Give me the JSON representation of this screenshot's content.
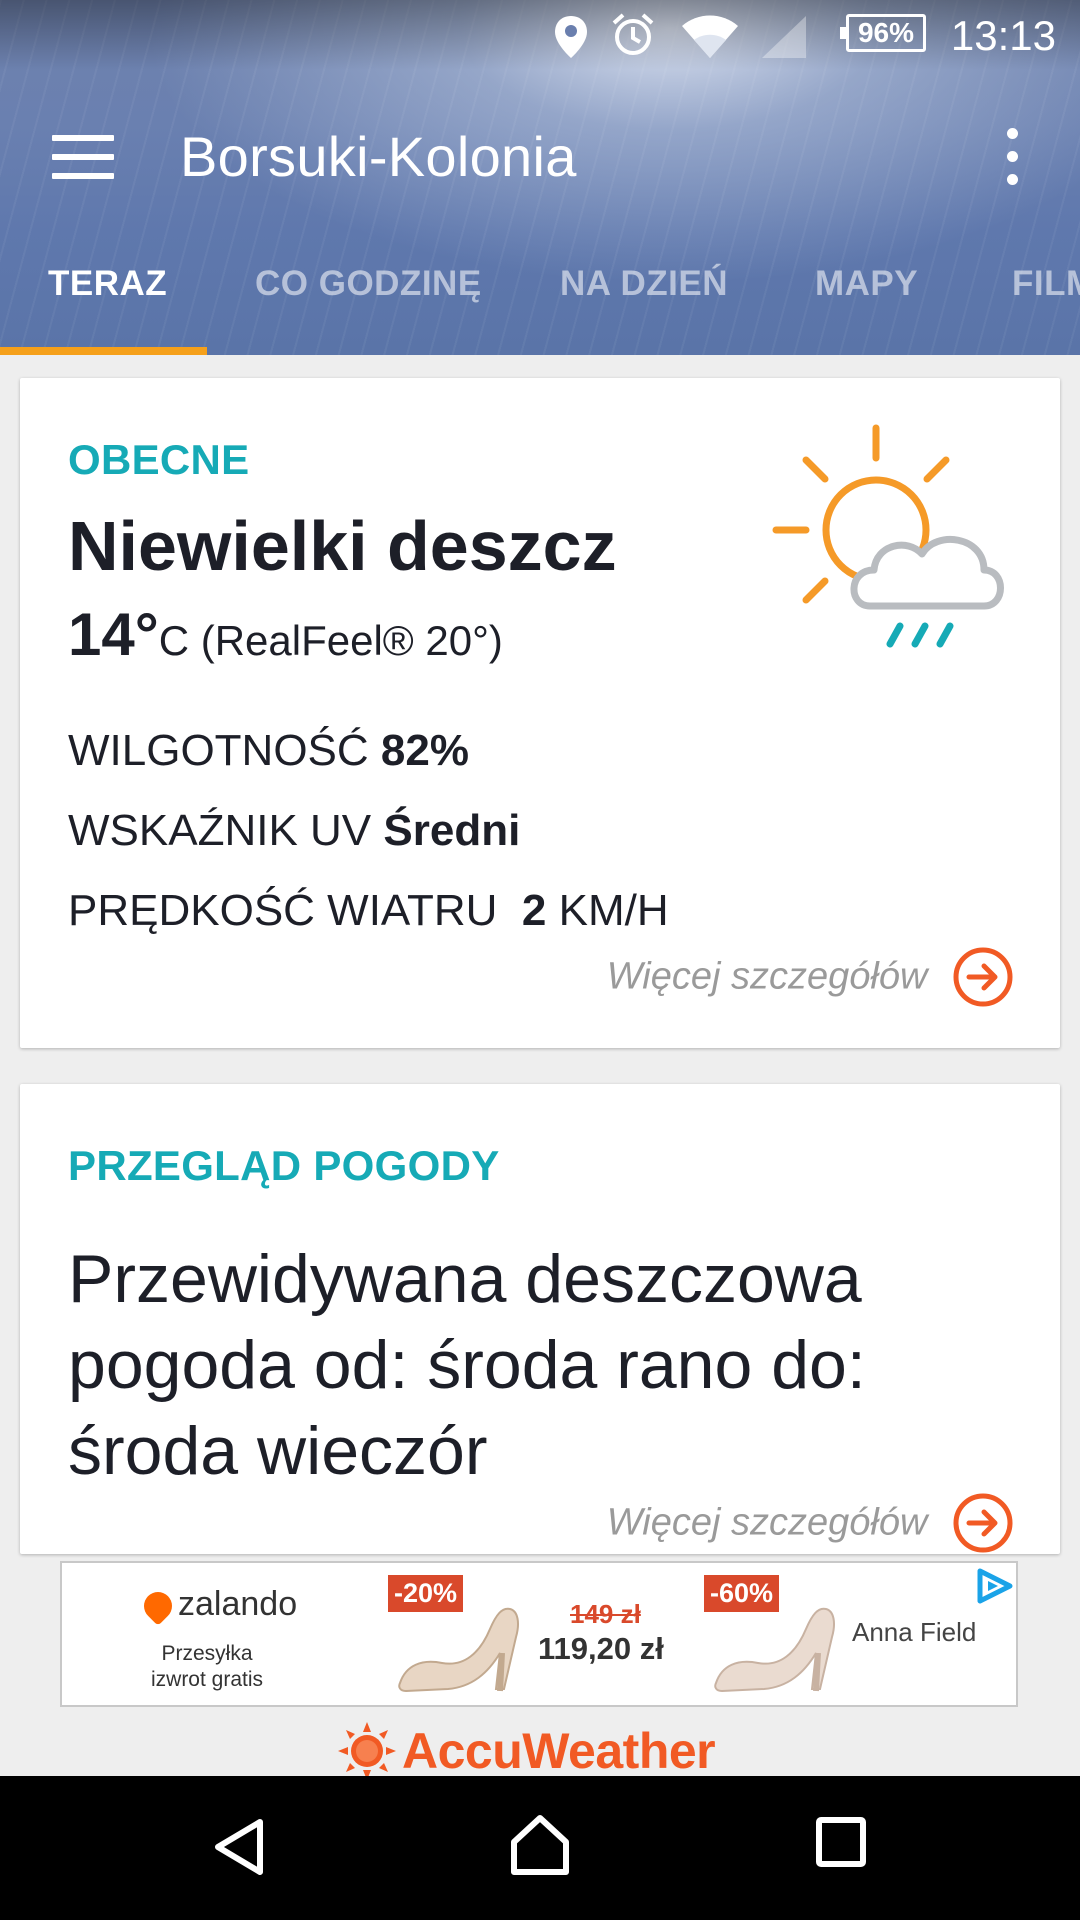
{
  "status_bar": {
    "time": "13:13",
    "battery": "96%",
    "icons": [
      "location-icon",
      "alarm-icon",
      "wifi-icon",
      "signal-icon",
      "battery-icon"
    ]
  },
  "toolbar": {
    "title": "Borsuki-Kolonia",
    "menu_icon": "hamburger-menu-icon",
    "overflow_icon": "more-vert-icon"
  },
  "tabs": [
    {
      "label": "TERAZ",
      "active": true
    },
    {
      "label": "CO GODZINĘ",
      "active": false
    },
    {
      "label": "NA DZIEŃ",
      "active": false
    },
    {
      "label": "MAPY",
      "active": false
    },
    {
      "label": "FILM",
      "active": false
    }
  ],
  "current": {
    "section_label": "OBECNE",
    "condition": "Niewielki deszcz",
    "temperature": "14°",
    "unit_realfeel": "C (RealFeel® 20°)",
    "humidity_label": "WILGOTNOŚĆ",
    "humidity_value": "82%",
    "uv_label": "WSKAŹNIK UV",
    "uv_value": "Średni",
    "wind_label": "PRĘDKOŚĆ WIATRU",
    "wind_value": "2",
    "wind_unit": "KM/H",
    "more_link": "Więcej szczegółów",
    "icon": "sun-cloud-rain-icon"
  },
  "overview": {
    "section_label": "PRZEGLĄD POGODY",
    "text": "Przewidywana deszczowa pogoda od: środa rano do: środa wieczór",
    "more_link": "Więcej szczegółów"
  },
  "ad": {
    "brand_logo": "zalando",
    "brand_sub": "Przesyłka izwrot gratis",
    "discount_1": "-20%",
    "price_old": "149 zł",
    "price_new": "119,20 zł",
    "discount_2": "-60%",
    "product_brand": "Anna Field"
  },
  "footer": {
    "brand": "AccuWeather"
  },
  "colors": {
    "accent_teal": "#16aab6",
    "accent_orange": "#f15a24",
    "tab_indicator": "#f5a01b"
  }
}
